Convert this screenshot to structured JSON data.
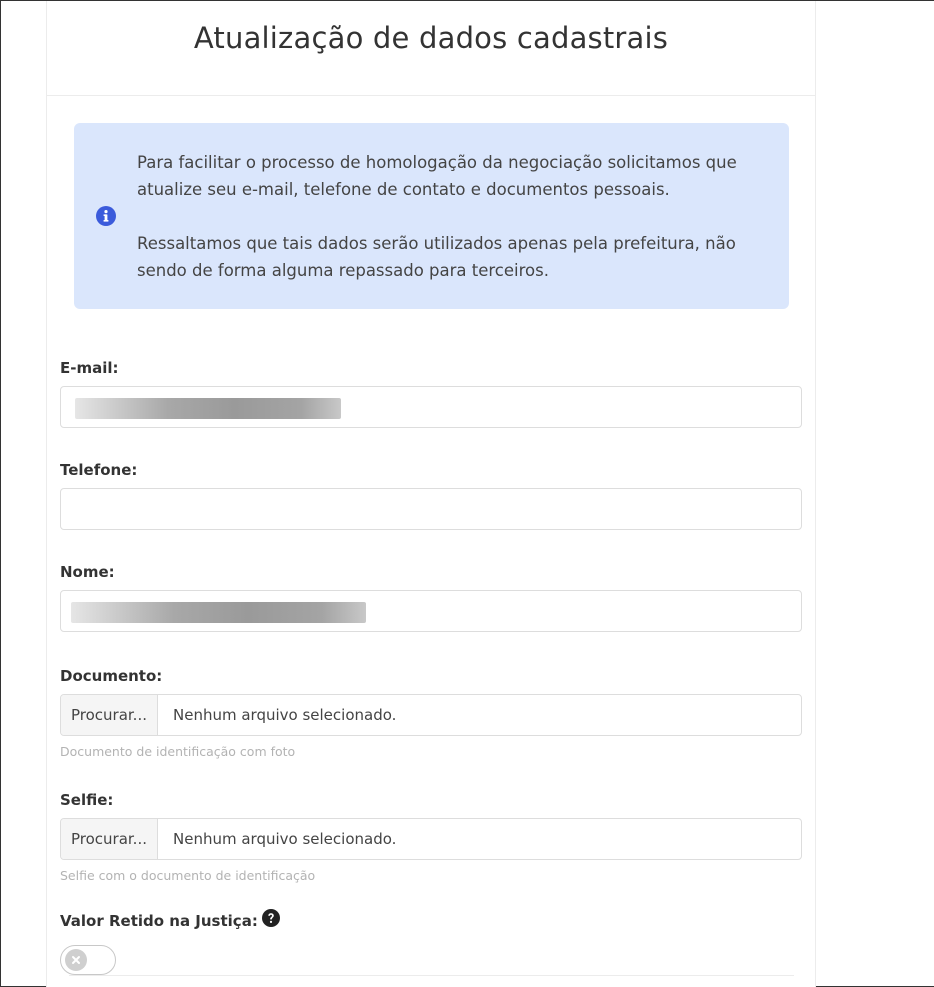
{
  "page": {
    "title": "Atualização de dados cadastrais"
  },
  "alert": {
    "icon": "info-circle-icon",
    "paragraph1": "Para facilitar o processo de homologação da negociação solicitamos que atualize seu e-mail, telefone de contato e documentos pessoais.",
    "paragraph2": "Ressaltamos que tais dados serão utilizados apenas pela prefeitura, não sendo de forma alguma repassado para terceiros.",
    "background": "#dae6fc",
    "icon_color": "#3b5bdb"
  },
  "form": {
    "email": {
      "label": "E-mail:",
      "value_redacted": true
    },
    "telefone": {
      "label": "Telefone:",
      "value": ""
    },
    "nome": {
      "label": "Nome:",
      "value_redacted": true
    },
    "documento": {
      "label": "Documento:",
      "button": "Procurar...",
      "status": "Nenhum arquivo selecionado.",
      "help": "Documento de identificação com foto"
    },
    "selfie": {
      "label": "Selfie:",
      "button": "Procurar...",
      "status": "Nenhum arquivo selecionado.",
      "help": "Selfie com o documento de identificação"
    },
    "valor_retido": {
      "label": "Valor Retido na Justiça:",
      "help_icon": "question-circle-icon",
      "toggle_on": false
    }
  }
}
